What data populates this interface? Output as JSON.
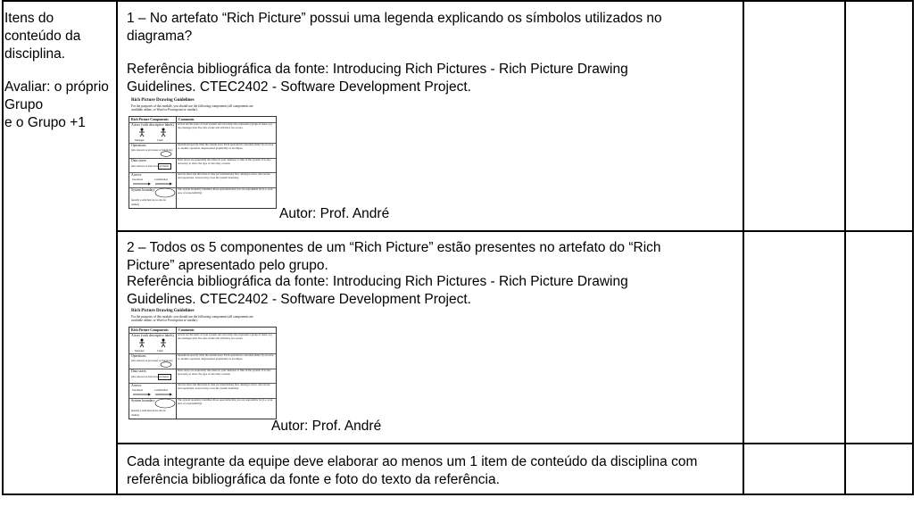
{
  "left_cell": {
    "items_label": "Itens do\nconteúdo da\ndisciplina.",
    "evaluate_label": "Avaliar: o próprio\nGrupo\ne o Grupo +1"
  },
  "rows": [
    {
      "question": "1 – No artefato “Rich Picture” possui uma legenda explicando os símbolos utilizados no\ndiagrama?",
      "reference": "Referência bibliográfica da fonte: Introducing Rich Pictures - Rich Picture Drawing\nGuidelines. CTEC2402 - Software Development Project.",
      "author": "Autor: Prof. André"
    },
    {
      "question": "2 – Todos os 5 componentes de um “Rich Picture” estão presentes no artefato do “Rich\nPicture” apresentado pelo grupo.",
      "reference": "Referência bibliográfica da fonte: Introducing Rich Pictures - Rich Picture Drawing\nGuidelines. CTEC2402 - Software Development Project.",
      "author": "Autor: Prof. André"
    },
    {
      "note": "Cada integrante da equipe deve elaborar ao menos um 1 item de conteúdo da disciplina com\nreferência bibliográfica da fonte e foto do texto da referência."
    }
  ],
  "reference_photo": {
    "title": "Rich Picture Drawing Guidelines",
    "intro": "For the purposes of this module, you should use the following components (all components are available online, or Word or Powerpoint or similar).",
    "col_component": "Rich Picture Components",
    "col_comments": "Comments",
    "components": [
      "Actors (with descriptive labels)",
      "Operations",
      "Data stores",
      "Arrows",
      "System boundary"
    ],
    "actor_labels": [
      "Manager",
      "Clerk"
    ],
    "op_note": "(also known as processes or functions)",
    "store_note": "(also known as data stores)",
    "store_box": "Clients",
    "arrow_labels": [
      "Unordered",
      "Confirmation"
    ],
    "boundary_note": "(usually a solid line but are also be dashed)",
    "comments": [
      "Actors are the users of your system. An actor may also represent a group of users, e.g. one manager plus five data clerks will still have two actors.",
      "Operations specify what the system does. Each operation is executed either by an actor or another operation. Represented graphically as an ellipse.",
      "Data stores are essentially the tables in your database or files in the system. It is also necessary to show the type of data they contain.",
      "Arrows show the direction of data (or information) flow amongst actors, data stores and operations. Arrows may cross the system boundary.",
      "The system boundary identifies those operations that you are responsible for (i.e. your area of responsibility)."
    ]
  }
}
